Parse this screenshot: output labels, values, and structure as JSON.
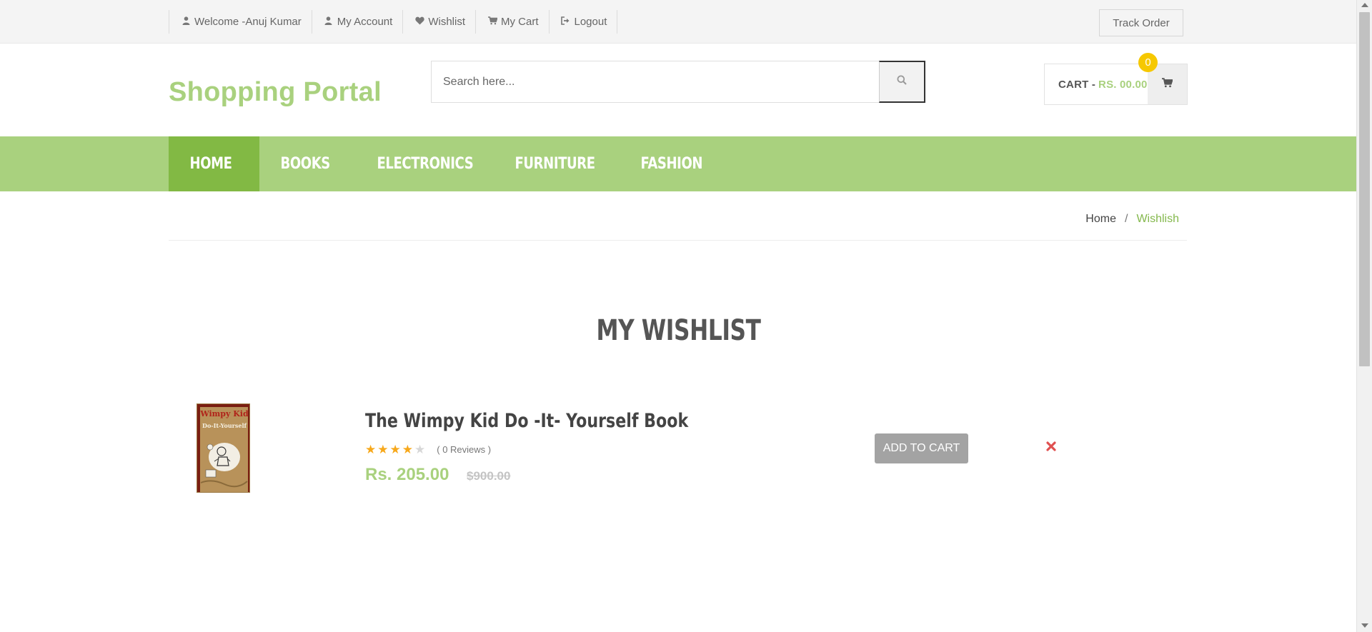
{
  "topbar": {
    "links": [
      {
        "icon": "user-icon",
        "label": "Welcome -Anuj Kumar"
      },
      {
        "icon": "user-icon",
        "label": "My Account"
      },
      {
        "icon": "heart-icon",
        "label": "Wishlist"
      },
      {
        "icon": "cart-icon",
        "label": "My Cart"
      },
      {
        "icon": "logout-icon",
        "label": "Logout"
      }
    ],
    "track_order_label": "Track Order"
  },
  "header": {
    "logo": "Shopping Portal",
    "search": {
      "placeholder": "Search here...",
      "value": ""
    },
    "cart": {
      "label": "CART -",
      "amount": "RS. 00.00",
      "count": "0"
    }
  },
  "nav": {
    "items": [
      {
        "label": "HOME",
        "active": true
      },
      {
        "label": "BOOKS",
        "active": false
      },
      {
        "label": "ELECTRONICS",
        "active": false
      },
      {
        "label": "FURNITURE",
        "active": false
      },
      {
        "label": "FASHION",
        "active": false
      }
    ]
  },
  "breadcrumb": {
    "home": "Home",
    "separator": "/",
    "current": "Wishlish"
  },
  "page": {
    "title": "MY WISHLIST"
  },
  "wishlist": {
    "items": [
      {
        "name": "The Wimpy Kid Do -It- Yourself Book",
        "rating": 4,
        "rating_max": 5,
        "reviews": "( 0 Reviews )",
        "price": "Rs. 205.00",
        "old_price": "$900.00",
        "add_to_cart_label": "ADD TO CART",
        "cover_title": "Wimpy Kid",
        "cover_subtitle": "Do-It-Yourself"
      }
    ]
  },
  "colors": {
    "brand_green": "#a9d17e",
    "nav_active": "#82b944",
    "badge": "#f6c800",
    "star": "#f7a81b",
    "remove": "#e05050"
  }
}
